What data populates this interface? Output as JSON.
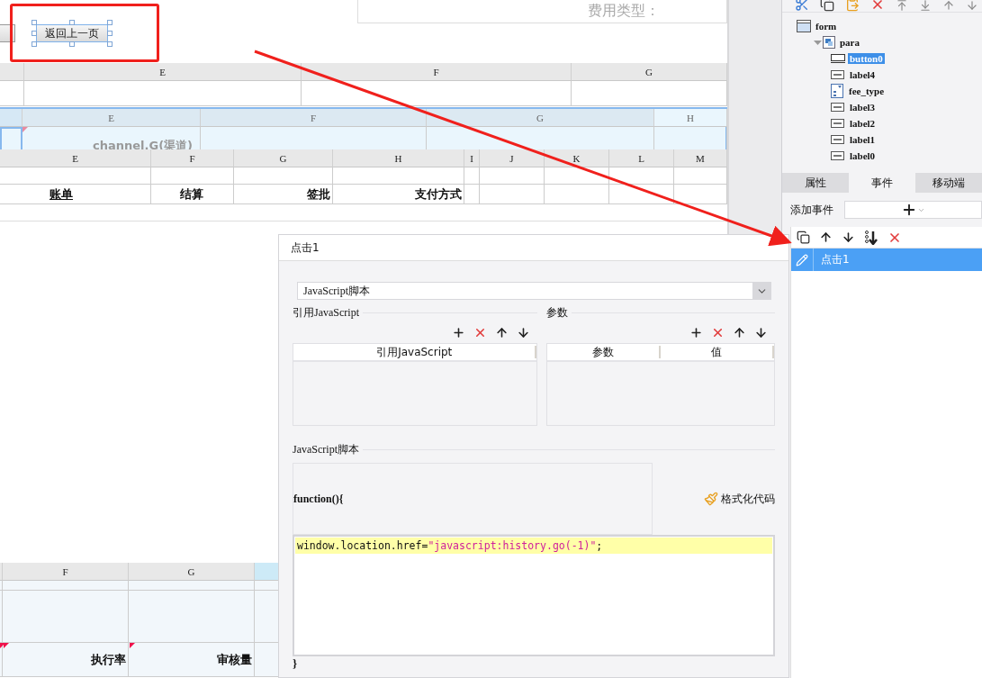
{
  "canvas": {
    "filter_label": "费用类型：",
    "back_button": {
      "label": "返回上一页",
      "selected": true
    },
    "sheet_top": {
      "columns": [
        "E",
        "F",
        "G"
      ]
    },
    "sheet_selected": {
      "selected": true,
      "columns": [
        "E",
        "F",
        "G",
        "H"
      ],
      "cell": "channel.G(渠道)"
    },
    "sheet_mid": {
      "columns": [
        "E",
        "F",
        "G",
        "H",
        "I",
        "J",
        "K",
        "L",
        "M"
      ],
      "labels": [
        {
          "text": "账单",
          "underline": true
        },
        {
          "text": "结算",
          "underline": false
        },
        {
          "text": "签批",
          "underline": false
        },
        {
          "text": "支付方式",
          "underline": false
        }
      ]
    },
    "sheet_bottom": {
      "columns": [
        "F",
        "G"
      ],
      "labels": [
        "执行率",
        "审核量"
      ]
    }
  },
  "dialog": {
    "title": "点击1",
    "script_type": "JavaScript脚本",
    "ref_section": {
      "title": "引用JavaScript",
      "columns": [
        "引用JavaScript"
      ]
    },
    "param_section": {
      "title": "参数",
      "columns": [
        "参数",
        "值"
      ]
    },
    "script_section": {
      "title": "JavaScript脚本",
      "header": "function(){",
      "format_button": "格式化代码",
      "code": [
        {
          "kind": "plain",
          "text": "window.location.href="
        },
        {
          "kind": "string",
          "text": "\"javascript:history.go(-1)\""
        },
        {
          "kind": "plain",
          "text": ";"
        }
      ],
      "footer": "}"
    }
  },
  "panel": {
    "tree": [
      {
        "label": "form",
        "kind": "form",
        "selected": false,
        "children": [
          {
            "label": "para",
            "kind": "para",
            "selected": false,
            "expanded": true,
            "children": [
              {
                "label": "button0",
                "kind": "button",
                "selected": true
              },
              {
                "label": "label4",
                "kind": "label",
                "selected": false
              },
              {
                "label": "fee_type",
                "kind": "combo",
                "selected": false
              },
              {
                "label": "label3",
                "kind": "label",
                "selected": false
              },
              {
                "label": "label2",
                "kind": "label",
                "selected": false
              },
              {
                "label": "label1",
                "kind": "label",
                "selected": false
              },
              {
                "label": "label0",
                "kind": "label",
                "selected": false
              }
            ]
          }
        ]
      }
    ],
    "tabs": [
      {
        "label": "属性",
        "selected": false
      },
      {
        "label": "事件",
        "selected": true
      },
      {
        "label": "移动端",
        "selected": false
      }
    ],
    "add_event_label": "添加事件",
    "events": [
      {
        "label": "点击1",
        "selected": true
      }
    ]
  }
}
